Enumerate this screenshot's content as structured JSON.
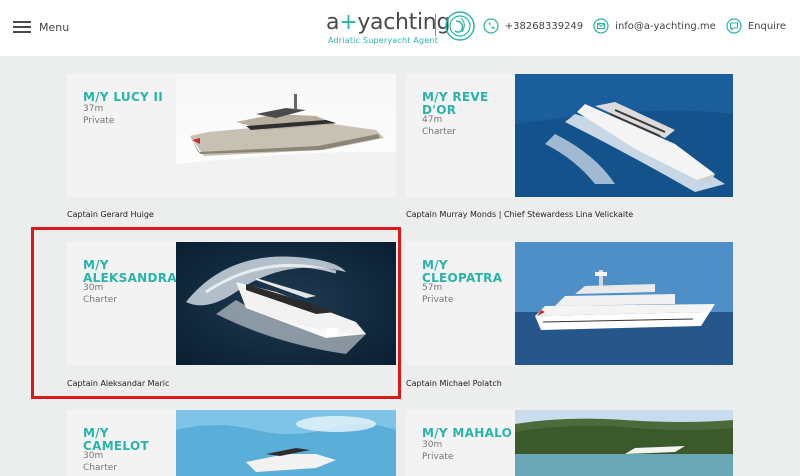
{
  "header": {
    "menu_label": "Menu",
    "logo_text_pre": "a",
    "logo_plus": "+",
    "logo_text_post": "yachting",
    "logo_tagline": "Adriatic Superyacht Agent",
    "phone": "+38268339249",
    "email": "info@a-yachting.me",
    "enquire": "Enquire",
    "icons": [
      "menu-icon",
      "phone-icon",
      "email-icon",
      "enquire-icon"
    ],
    "accent_color": "#2ab3a8"
  },
  "yachts": [
    {
      "name_line1": "M/Y LUCY II",
      "name_line2": "",
      "length": "37m",
      "type": "Private",
      "caption": "Captain Gerard Huige"
    },
    {
      "name_line1": "M/Y REVE",
      "name_line2": "D'OR",
      "length": "47m",
      "type": "Charter",
      "caption": "Captain Murray Monds | Chief Stewardess Lina Velickaite"
    },
    {
      "name_line1": "M/Y",
      "name_line2": "ALEKSANDRA",
      "length": "30m",
      "type": "Charter",
      "caption": "Captain Aleksandar Maric"
    },
    {
      "name_line1": "M/Y",
      "name_line2": "CLEOPATRA",
      "length": "57m",
      "type": "Private",
      "caption": "Captain Michael Polatch"
    },
    {
      "name_line1": "M/Y",
      "name_line2": "CAMELOT",
      "length": "30m",
      "type": "Charter",
      "caption": ""
    },
    {
      "name_line1": "M/Y MAHALO",
      "name_line2": "",
      "length": "30m",
      "type": "Private",
      "caption": ""
    }
  ]
}
